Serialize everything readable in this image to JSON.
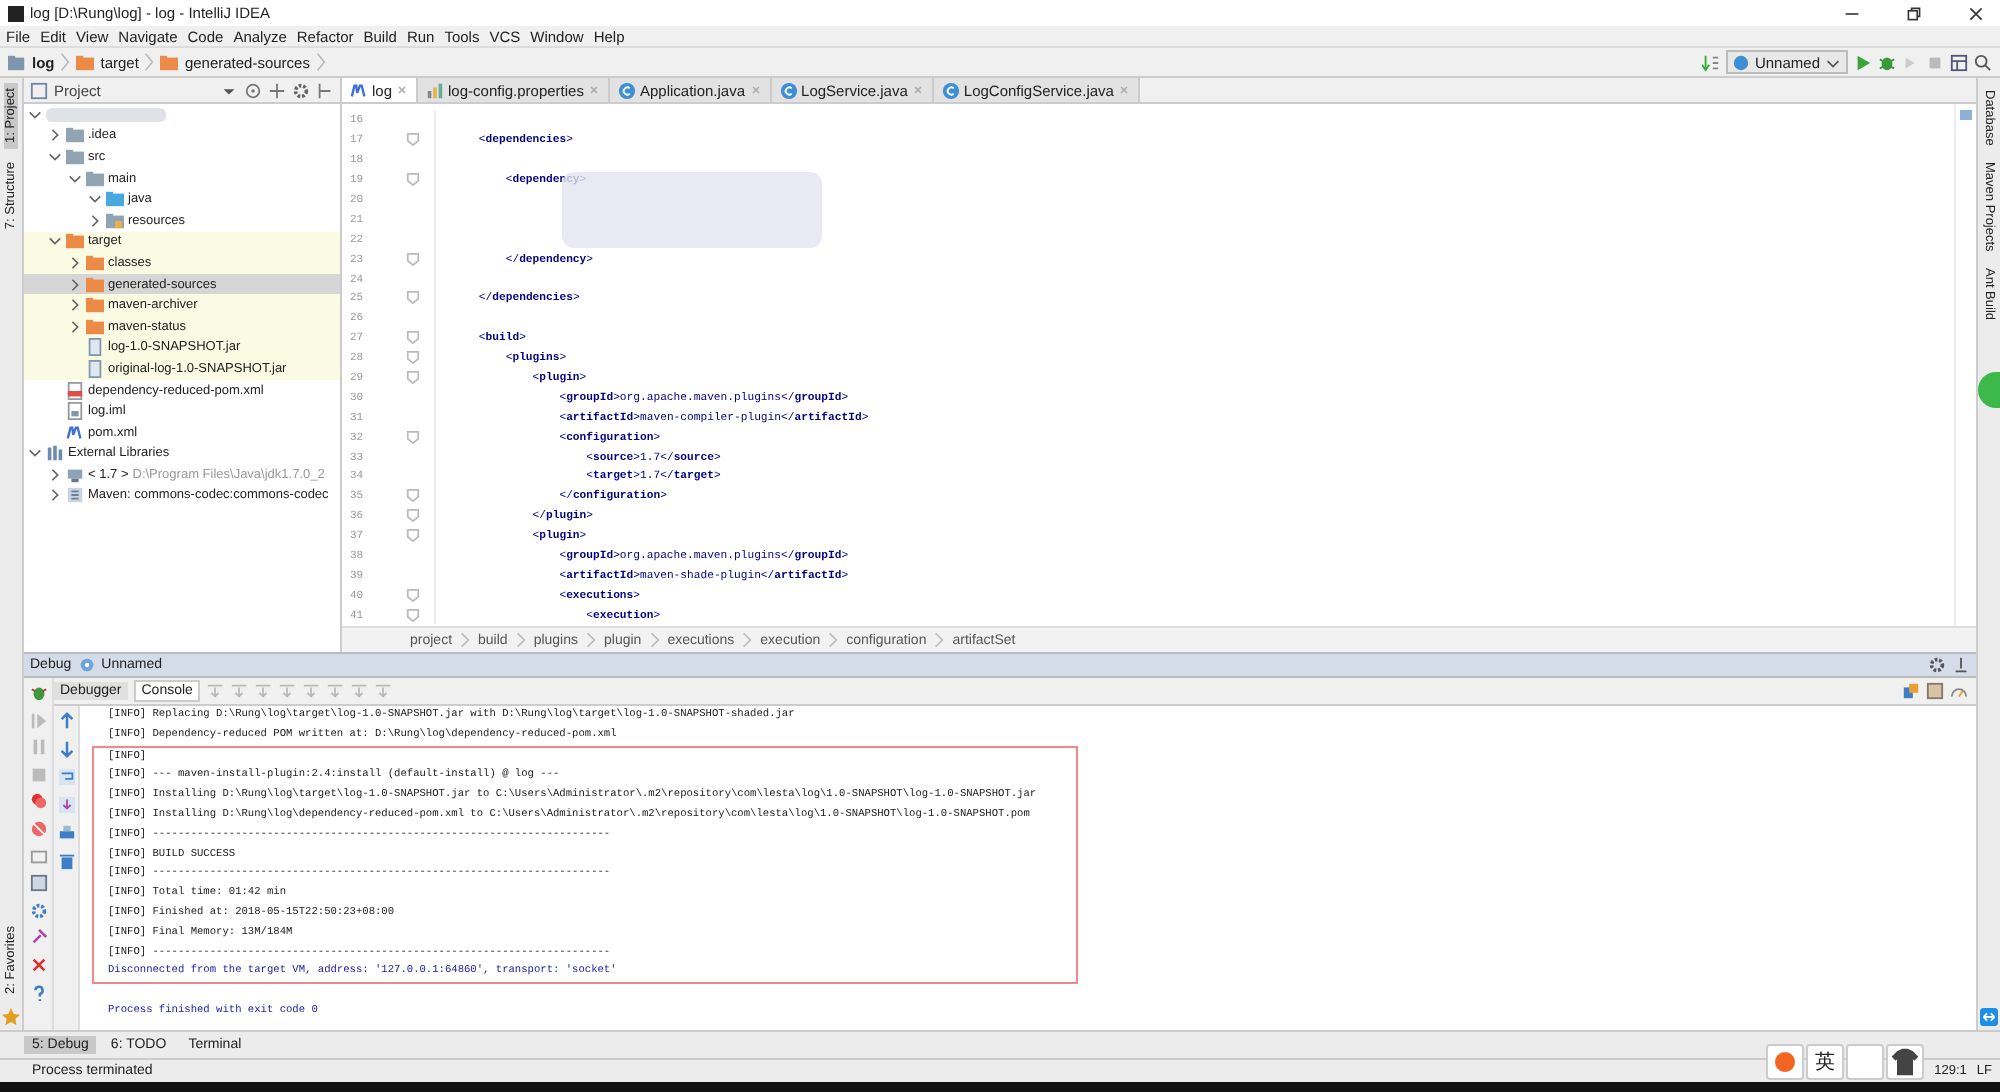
{
  "window": {
    "title": "log [D:\\Rung\\log] - log - IntelliJ IDEA"
  },
  "menu": [
    "File",
    "Edit",
    "View",
    "Navigate",
    "Code",
    "Analyze",
    "Refactor",
    "Build",
    "Run",
    "Tools",
    "VCS",
    "Window",
    "Help"
  ],
  "navigation_bar": {
    "crumbs": [
      {
        "label": "log",
        "kind": "module"
      },
      {
        "label": "target",
        "kind": "folder"
      },
      {
        "label": "generated-sources",
        "kind": "folder"
      }
    ],
    "run_config": "Unnamed"
  },
  "left_tool_strip": [
    {
      "label": "1: Project",
      "selected": true
    },
    {
      "label": "7: Structure",
      "selected": false
    }
  ],
  "favorites_strip": {
    "label": "2: Favorites"
  },
  "right_tool_strip": [
    "Database",
    "Maven Projects",
    "Ant Build"
  ],
  "project_panel": {
    "title": "Project",
    "root": {
      "expanded": true,
      "children": [
        {
          "label": ".idea",
          "kind": "folder",
          "expanded": false
        },
        {
          "label": "src",
          "kind": "folder",
          "expanded": true,
          "children": [
            {
              "label": "main",
              "kind": "folder",
              "expanded": true,
              "children": [
                {
                  "label": "java",
                  "kind": "source",
                  "expanded": true
                },
                {
                  "label": "resources",
                  "kind": "resources",
                  "expanded": false
                }
              ]
            }
          ]
        },
        {
          "label": "target",
          "kind": "excluded",
          "expanded": true,
          "excluded": true,
          "children": [
            {
              "label": "classes",
              "kind": "excluded",
              "expanded": false
            },
            {
              "label": "generated-sources",
              "kind": "excluded",
              "expanded": false,
              "selected": true
            },
            {
              "label": "maven-archiver",
              "kind": "excluded",
              "expanded": false
            },
            {
              "label": "maven-status",
              "kind": "excluded",
              "expanded": false
            },
            {
              "label": "log-1.0-SNAPSHOT.jar",
              "kind": "jar"
            },
            {
              "label": "original-log-1.0-SNAPSHOT.jar",
              "kind": "jar"
            }
          ]
        },
        {
          "label": "dependency-reduced-pom.xml",
          "kind": "xml"
        },
        {
          "label": "log.iml",
          "kind": "iml"
        },
        {
          "label": "pom.xml",
          "kind": "maven"
        }
      ]
    },
    "libraries": {
      "label": "External Libraries",
      "expanded": true,
      "children": [
        {
          "label": "< 1.7 >",
          "hint": "D:\\Program Files\\Java\\jdk1.7.0_2",
          "kind": "sdk",
          "expanded": false
        },
        {
          "label": "Maven: commons-codec:commons-codec",
          "kind": "library",
          "expanded": false
        }
      ]
    }
  },
  "editor_tabs": [
    {
      "label": "log",
      "kind": "maven",
      "selected": true
    },
    {
      "label": "log-config.properties",
      "kind": "properties",
      "selected": false
    },
    {
      "label": "Application.java",
      "kind": "class",
      "selected": false
    },
    {
      "label": "LogService.java",
      "kind": "class",
      "selected": false
    },
    {
      "label": "LogConfigService.java",
      "kind": "class",
      "selected": false
    }
  ],
  "editor": {
    "lines": [
      {
        "number": "16",
        "fold": false
      },
      {
        "number": "17",
        "code": "    <**dependencies**>",
        "fold": true
      },
      {
        "number": "18",
        "fold": false
      },
      {
        "number": "19",
        "code": "        <**dependency**>",
        "fold": true
      },
      {
        "number": "20",
        "fold": false
      },
      {
        "number": "21",
        "fold": false
      },
      {
        "number": "22",
        "fold": false
      },
      {
        "number": "23",
        "code": "        </**dependency**>",
        "fold": true
      },
      {
        "number": "24",
        "fold": false
      },
      {
        "number": "25",
        "code": "    </**dependencies**>",
        "fold": true
      },
      {
        "number": "26",
        "fold": false
      },
      {
        "number": "27",
        "code": "    <**build**>",
        "fold": true
      },
      {
        "number": "28",
        "code": "        <**plugins**>",
        "fold": true
      },
      {
        "number": "29",
        "code": "            <**plugin**>",
        "fold": true
      },
      {
        "number": "30",
        "code": "                <**groupId**>org.apache.maven.plugins</**groupId**>",
        "fold": false
      },
      {
        "number": "31",
        "code": "                <**artifactId**>maven-compiler-plugin</**artifactId**>",
        "fold": false
      },
      {
        "number": "32",
        "code": "                <**configuration**>",
        "fold": true
      },
      {
        "number": "33",
        "code": "                    <**source**>1.7</**source**>",
        "fold": false
      },
      {
        "number": "34",
        "code": "                    <**target**>1.7</**target**>",
        "fold": false
      },
      {
        "number": "35",
        "code": "                </**configuration**>",
        "fold": true
      },
      {
        "number": "36",
        "code": "            </**plugin**>",
        "fold": true
      },
      {
        "number": "37",
        "code": "            <**plugin**>",
        "fold": true
      },
      {
        "number": "38",
        "code": "                <**groupId**>org.apache.maven.plugins</**groupId**>",
        "fold": false
      },
      {
        "number": "39",
        "code": "                <**artifactId**>maven-shade-plugin</**artifactId**>",
        "fold": false
      },
      {
        "number": "40",
        "code": "                <**executions**>",
        "fold": true
      },
      {
        "number": "41",
        "code": "                    <**execution**>",
        "fold": true
      }
    ],
    "breadcrumbs": [
      "project",
      "build",
      "plugins",
      "plugin",
      "executions",
      "execution",
      "configuration",
      "artifactSet"
    ]
  },
  "debug": {
    "title": "Debug",
    "config": "Unnamed",
    "tabs": [
      {
        "label": "Debugger",
        "selected": false
      },
      {
        "label": "Console",
        "selected": true
      }
    ],
    "console": {
      "before": [
        {
          "kind": "info",
          "text": "[INFO] Replacing D:\\Rung\\log\\target\\log-1.0-SNAPSHOT.jar with D:\\Rung\\log\\target\\log-1.0-SNAPSHOT-shaded.jar"
        },
        {
          "kind": "info",
          "text": "[INFO] Dependency-reduced POM written at: D:\\Rung\\log\\dependency-reduced-pom.xml"
        }
      ],
      "highlighted": [
        {
          "kind": "info",
          "text": "[INFO]"
        },
        {
          "kind": "info",
          "text": "[INFO] --- maven-install-plugin:2.4:install (default-install) @ log ---"
        },
        {
          "kind": "info",
          "text": "[INFO] Installing D:\\Rung\\log\\target\\log-1.0-SNAPSHOT.jar to C:\\Users\\Administrator\\.m2\\repository\\com\\lesta\\log\\1.0-SNAPSHOT\\log-1.0-SNAPSHOT.jar"
        },
        {
          "kind": "info",
          "text": "[INFO] Installing D:\\Rung\\log\\dependency-reduced-pom.xml to C:\\Users\\Administrator\\.m2\\repository\\com\\lesta\\log\\1.0-SNAPSHOT\\log-1.0-SNAPSHOT.pom"
        },
        {
          "kind": "info",
          "text": "[INFO] ------------------------------------------------------------------------"
        },
        {
          "kind": "info",
          "text": "[INFO] BUILD SUCCESS"
        },
        {
          "kind": "info",
          "text": "[INFO] ------------------------------------------------------------------------"
        },
        {
          "kind": "info",
          "text": "[INFO] Total time: 01:42 min"
        },
        {
          "kind": "info",
          "text": "[INFO] Finished at: 2018-05-15T22:50:23+08:00"
        },
        {
          "kind": "info",
          "text": "[INFO] Final Memory: 13M/184M"
        },
        {
          "kind": "info",
          "text": "[INFO] ------------------------------------------------------------------------"
        },
        {
          "kind": "system",
          "text": "Disconnected from the target VM, address: '127.0.0.1:64860', transport: 'socket'"
        }
      ],
      "after": [
        {
          "kind": "system",
          "text": "Process finished with exit code 0"
        }
      ]
    }
  },
  "bottom_tabs": [
    {
      "label": "5: Debug",
      "selected": true
    },
    {
      "label": "6: TODO",
      "selected": false
    },
    {
      "label": "Terminal",
      "selected": false
    }
  ],
  "status_bar": {
    "message": "Process terminated",
    "position": "129:1",
    "line_separator": "LF"
  },
  "ime_bar": {
    "language": "英"
  }
}
